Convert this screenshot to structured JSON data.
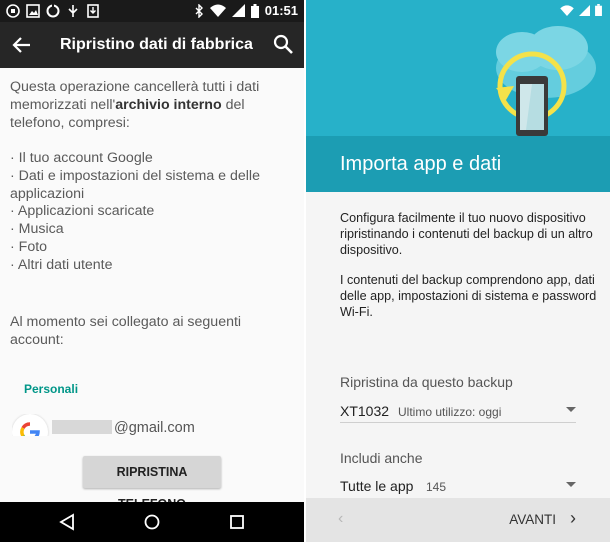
{
  "left": {
    "status_time": "01:51",
    "appbar_title": "Ripristino dati di fabbrica",
    "intro_before": "Questa operazione cancellerà tutti i dati memorizzati nell'",
    "intro_bold": "archivio interno",
    "intro_after": " del telefono, compresi:",
    "items": [
      "· Il tuo account Google",
      "· Dati e impostazioni del sistema e delle applicazioni",
      "· Applicazioni scaricate",
      "· Musica",
      "· Foto",
      "· Altri dati utente"
    ],
    "accounts_intro": "Al momento sei collegato ai seguenti account:",
    "personal_label": "Personali",
    "account_email": "@gmail.com",
    "reset_button": "RIPRISTINA TELEFONO"
  },
  "right": {
    "title": "Importa app e dati",
    "body_1": "Configura facilmente il tuo nuovo dispositivo ripristinando i contenuti del backup di un altro dispositivo.",
    "body_2": "I contenuti del backup comprendono app, dati delle app, impostazioni di sistema e password Wi-Fi.",
    "restore_label": "Ripristina da questo backup",
    "backup_device": "XT1032",
    "backup_last_used": "Ultimo utilizzo: oggi",
    "include_label": "Includi anche",
    "include_value": "Tutte le app",
    "include_count": "145",
    "prev_glyph": "‹",
    "next_label": "AVANTI",
    "next_glyph": "›"
  },
  "colors": {
    "hero": "#27b1c9",
    "header": "#1c9db3",
    "accent_teal": "#009688",
    "appbar": "#262626"
  },
  "icons": [
    "notification-icon",
    "image-icon",
    "sync-icon",
    "usb-icon",
    "download-icon",
    "bluetooth-icon",
    "wifi-icon",
    "signal-icon",
    "battery-icon",
    "back-arrow-icon",
    "search-icon",
    "google-icon",
    "nav-back-icon",
    "nav-home-icon",
    "nav-recents-icon",
    "cloud-restore-icon",
    "phone-icon"
  ]
}
